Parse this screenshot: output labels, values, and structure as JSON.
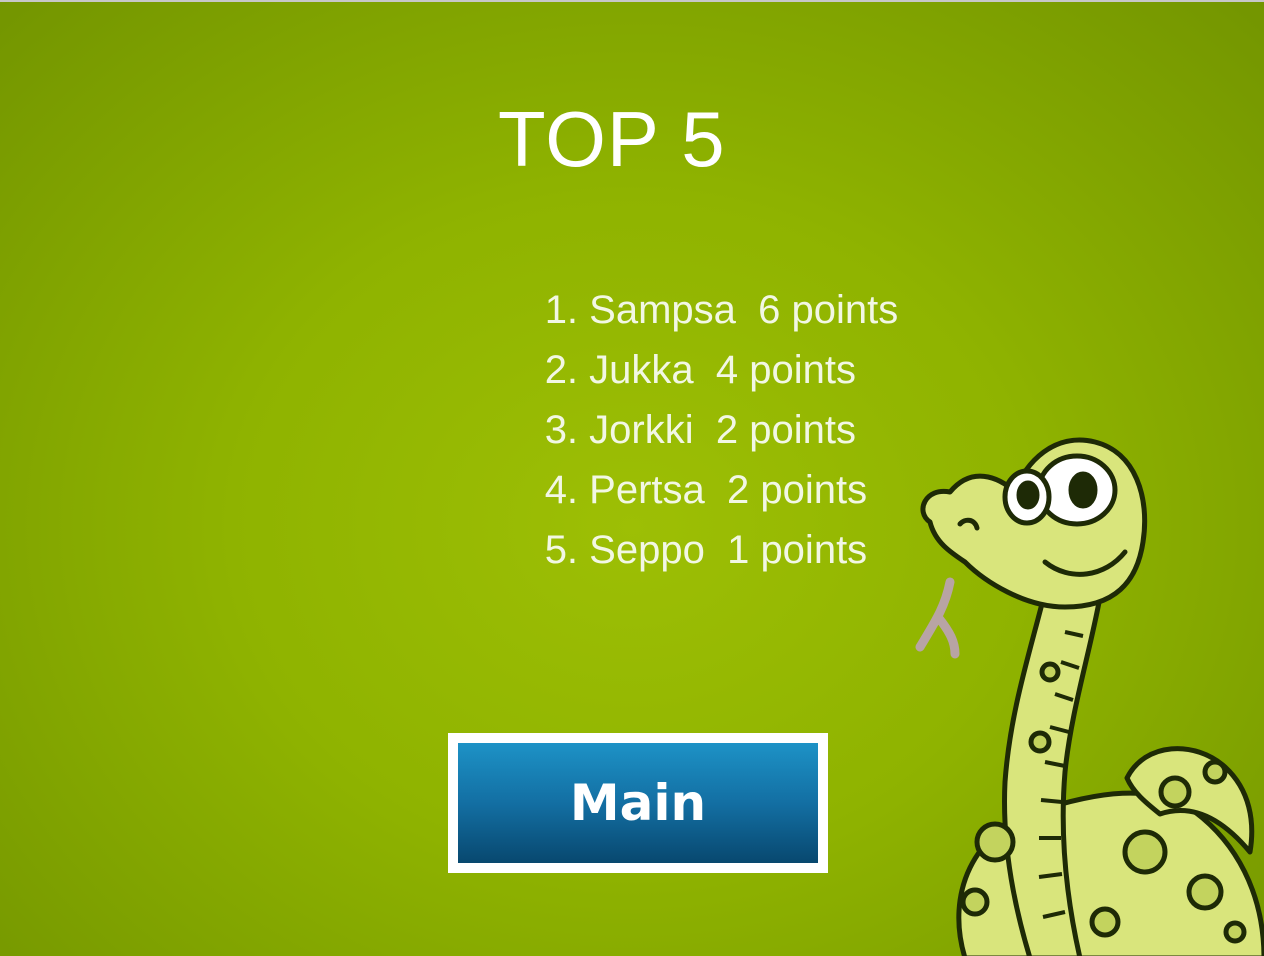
{
  "leaderboard": {
    "title": "TOP 5",
    "entries": [
      {
        "rank": "1.",
        "name": "Sampsa",
        "points": "6 points"
      },
      {
        "rank": "2.",
        "name": "Jukka",
        "points": "4 points"
      },
      {
        "rank": "3.",
        "name": "Jorkki",
        "points": "2 points"
      },
      {
        "rank": "4.",
        "name": "Pertsa",
        "points": "2 points"
      },
      {
        "rank": "5.",
        "name": "Seppo",
        "points": "1 points"
      }
    ]
  },
  "buttons": {
    "main_label": "Main"
  },
  "mascot": {
    "icon": "snake-mascot-icon"
  },
  "colors": {
    "background": "#8fb300",
    "button": "#136fa3",
    "snake_body": "#d9e57c"
  }
}
